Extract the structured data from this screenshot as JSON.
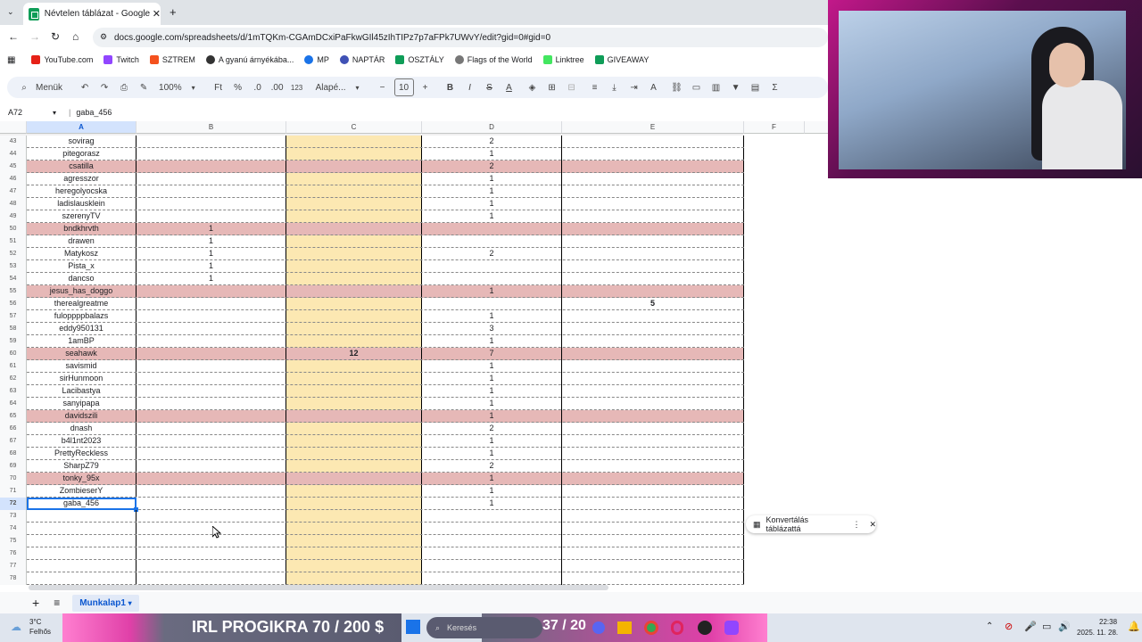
{
  "browser": {
    "tab_title": "Névtelen táblázat - Google Táb",
    "url": "docs.google.com/spreadsheets/d/1mTQKm-CGAmDCxiPaFkwGIl45zIhTIPz7p7aFPk7UWvY/edit?gid=0#gid=0",
    "bookmarks": [
      "YouTube.com",
      "Twitch",
      "SZTREM",
      "A gyanú árnyékába...",
      "MP",
      "NAPTÁR",
      "OSZTÁLY",
      "Flags of the World",
      "Linktree",
      "GIVEAWAY"
    ]
  },
  "toolbar": {
    "menus_label": "Menük",
    "zoom": "100%",
    "currency": "Ft",
    "percent": "%",
    "dec_less": ".0",
    "dec_more": ".00",
    "format_num": "123",
    "font": "Alapé...",
    "font_size": "10"
  },
  "formula": {
    "cell_ref": "A72",
    "content": "gaba_456"
  },
  "columns": [
    "A",
    "B",
    "C",
    "D",
    "E",
    "F"
  ],
  "rows": [
    {
      "n": "43",
      "a": "sovirag",
      "b": "",
      "c": "",
      "d": "2",
      "e": "",
      "hl": false
    },
    {
      "n": "44",
      "a": "pitegorasz",
      "b": "",
      "c": "",
      "d": "1",
      "e": "",
      "hl": false
    },
    {
      "n": "45",
      "a": "csatilla",
      "b": "",
      "c": "",
      "d": "2",
      "e": "",
      "hl": true
    },
    {
      "n": "46",
      "a": "agresszor",
      "b": "",
      "c": "",
      "d": "1",
      "e": "",
      "hl": false
    },
    {
      "n": "47",
      "a": "heregolyocska",
      "b": "",
      "c": "",
      "d": "1",
      "e": "",
      "hl": false
    },
    {
      "n": "48",
      "a": "ladislausklein",
      "b": "",
      "c": "",
      "d": "1",
      "e": "",
      "hl": false
    },
    {
      "n": "49",
      "a": "szerenyTV",
      "b": "",
      "c": "",
      "d": "1",
      "e": "",
      "hl": false
    },
    {
      "n": "50",
      "a": "bndkhrvth",
      "b": "1",
      "c": "",
      "d": "",
      "e": "",
      "hl": true
    },
    {
      "n": "51",
      "a": "drawen",
      "b": "1",
      "c": "",
      "d": "",
      "e": "",
      "hl": false
    },
    {
      "n": "52",
      "a": "Matykosz",
      "b": "1",
      "c": "",
      "d": "2",
      "e": "",
      "hl": false
    },
    {
      "n": "53",
      "a": "Pista_x",
      "b": "1",
      "c": "",
      "d": "",
      "e": "",
      "hl": false
    },
    {
      "n": "54",
      "a": "dancso",
      "b": "1",
      "c": "",
      "d": "",
      "e": "",
      "hl": false
    },
    {
      "n": "55",
      "a": "jesus_has_doggo",
      "b": "",
      "c": "",
      "d": "1",
      "e": "",
      "hl": true
    },
    {
      "n": "56",
      "a": "therealgreatme",
      "b": "",
      "c": "",
      "d": "",
      "e": "5",
      "hl": false
    },
    {
      "n": "57",
      "a": "fuloppppbalazs",
      "b": "",
      "c": "",
      "d": "1",
      "e": "",
      "hl": false
    },
    {
      "n": "58",
      "a": "eddy950131",
      "b": "",
      "c": "",
      "d": "3",
      "e": "",
      "hl": false
    },
    {
      "n": "59",
      "a": "1amBP",
      "b": "",
      "c": "",
      "d": "1",
      "e": "",
      "hl": false
    },
    {
      "n": "60",
      "a": "seahawk",
      "b": "",
      "c": "12",
      "d": "7",
      "e": "",
      "hl": true
    },
    {
      "n": "61",
      "a": "savismid",
      "b": "",
      "c": "",
      "d": "1",
      "e": "",
      "hl": false
    },
    {
      "n": "62",
      "a": "sirHunmoon",
      "b": "",
      "c": "",
      "d": "1",
      "e": "",
      "hl": false
    },
    {
      "n": "63",
      "a": "Lacibastya",
      "b": "",
      "c": "",
      "d": "1",
      "e": "",
      "hl": false
    },
    {
      "n": "64",
      "a": "sanyipapa",
      "b": "",
      "c": "",
      "d": "1",
      "e": "",
      "hl": false
    },
    {
      "n": "65",
      "a": "davidszili",
      "b": "",
      "c": "",
      "d": "1",
      "e": "",
      "hl": true
    },
    {
      "n": "66",
      "a": "dnash",
      "b": "",
      "c": "",
      "d": "2",
      "e": "",
      "hl": false
    },
    {
      "n": "67",
      "a": "b4l1nt2023",
      "b": "",
      "c": "",
      "d": "1",
      "e": "",
      "hl": false
    },
    {
      "n": "68",
      "a": "PrettyReckless",
      "b": "",
      "c": "",
      "d": "1",
      "e": "",
      "hl": false
    },
    {
      "n": "69",
      "a": "SharpZ79",
      "b": "",
      "c": "",
      "d": "2",
      "e": "",
      "hl": false
    },
    {
      "n": "70",
      "a": "tonky_95x",
      "b": "",
      "c": "",
      "d": "1",
      "e": "",
      "hl": true
    },
    {
      "n": "71",
      "a": "ZombieserY",
      "b": "",
      "c": "",
      "d": "1",
      "e": "",
      "hl": false
    },
    {
      "n": "72",
      "a": "gaba_456",
      "b": "",
      "c": "",
      "d": "1",
      "e": "",
      "hl": false
    },
    {
      "n": "73",
      "a": "",
      "b": "",
      "c": "",
      "d": "",
      "e": "",
      "hl": false
    },
    {
      "n": "74",
      "a": "",
      "b": "",
      "c": "",
      "d": "",
      "e": "",
      "hl": false
    },
    {
      "n": "75",
      "a": "",
      "b": "",
      "c": "",
      "d": "",
      "e": "",
      "hl": false
    },
    {
      "n": "76",
      "a": "",
      "b": "",
      "c": "",
      "d": "",
      "e": "",
      "hl": false
    },
    {
      "n": "77",
      "a": "",
      "b": "",
      "c": "",
      "d": "",
      "e": "",
      "hl": false
    },
    {
      "n": "78",
      "a": "",
      "b": "",
      "c": "",
      "d": "",
      "e": "",
      "hl": false
    }
  ],
  "chip": {
    "label": "Konvertálás táblázattá"
  },
  "sheet_tab": "Munkalap1",
  "taskbar": {
    "weather_temp": "3°C",
    "weather_desc": "Felhős",
    "banner": "IRL PROGIKRA 70 / 200 $",
    "search": "Keresés",
    "counter": "37 / 20",
    "time": "22:38",
    "date": "2025. 11. 28."
  },
  "colors": {
    "highlight_row": "#e6b8b7",
    "col_c_fill": "#fce8b2",
    "selection": "#1a73e8"
  }
}
